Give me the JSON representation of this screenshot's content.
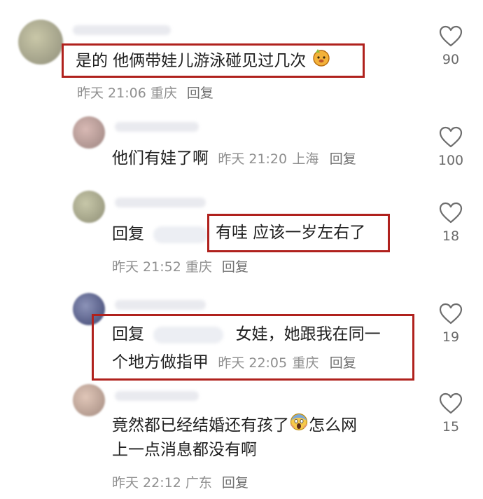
{
  "comments": [
    {
      "text": "是的 他俩带娃儿游泳碰见过几次",
      "emoji": "cat-face-emoji",
      "time": "昨天 21:06",
      "location": "重庆",
      "reply_label": "回复",
      "likes": "90"
    },
    {
      "text": "他们有娃了啊",
      "time": "昨天 21:20",
      "location": "上海",
      "reply_label": "回复",
      "likes": "100"
    },
    {
      "reply_prefix": "回复",
      "text": "有哇 应该一岁左右了",
      "time": "昨天 21:52",
      "location": "重庆",
      "reply_label": "回复",
      "likes": "18"
    },
    {
      "reply_prefix": "回复",
      "text_line1": "女娃，她跟我在同一",
      "text_line2": "个地方做指甲",
      "time": "昨天 22:05",
      "location": "重庆",
      "reply_label": "回复",
      "likes": "19"
    },
    {
      "text_line1a": "竟然都已经结婚还有孩了",
      "emoji": "screaming-face-emoji",
      "text_line1b": "怎么网",
      "text_line2": "上一点消息都没有啊",
      "time": "昨天 22:12",
      "location": "广东",
      "reply_label": "回复",
      "likes": "15"
    }
  ],
  "colors": {
    "highlight_box": "#b0211d",
    "meta_text": "#8f8f8f"
  },
  "icons": {
    "like": "heart-outline-icon"
  }
}
